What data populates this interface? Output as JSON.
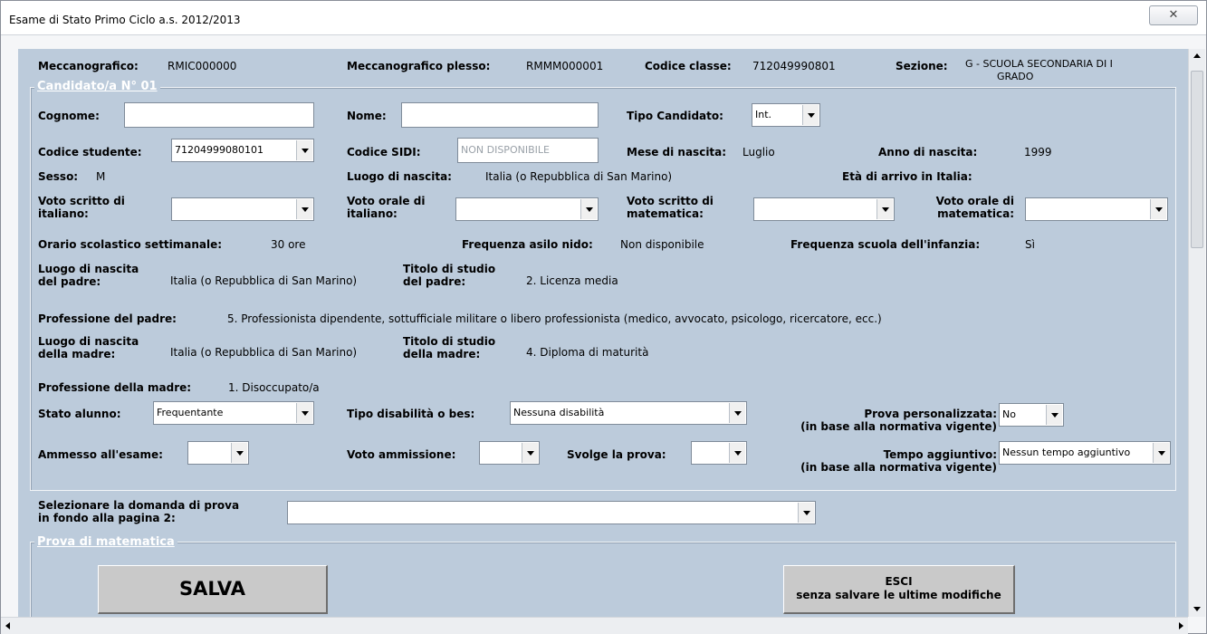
{
  "window": {
    "title": "Esame di Stato Primo Ciclo a.s. 2012/2013",
    "close_glyph": "✕"
  },
  "header": {
    "meccanografico_label": "Meccanografico:",
    "meccanografico_value": "RMIC000000",
    "plesso_label": "Meccanografico plesso:",
    "plesso_value": "RMMM000001",
    "classe_label": "Codice classe:",
    "classe_value": "712049990801",
    "sezione_label": "Sezione:",
    "sezione_value_1": "G  - SCUOLA SECONDARIA DI I",
    "sezione_value_2": "GRADO"
  },
  "candidato": {
    "legend": "Candidato/a N° 01",
    "cognome_label": "Cognome:",
    "cognome_value": "",
    "nome_label": "Nome:",
    "nome_value": "",
    "tipo_label": "Tipo Candidato:",
    "tipo_value": "Int.",
    "codice_studente_label": "Codice studente:",
    "codice_studente_value": "71204999080101",
    "codice_sidi_label": "Codice SIDI:",
    "codice_sidi_value": "NON DISPONIBILE",
    "mese_label": "Mese di nascita:",
    "mese_value": "Luglio",
    "anno_label": "Anno di nascita:",
    "anno_value": "1999",
    "sesso_label": "Sesso:",
    "sesso_value": "M",
    "luogo_label": "Luogo di nascita:",
    "luogo_value": "Italia (o Repubblica di San Marino)",
    "eta_label": "Età di arrivo in Italia:",
    "voto_scritto_ita_1": "Voto scritto di",
    "voto_scritto_ita_2": "italiano:",
    "voto_scritto_ita_value": "",
    "voto_orale_ita_1": "Voto orale di",
    "voto_orale_ita_2": "italiano:",
    "voto_orale_ita_value": "",
    "voto_scritto_mat_1": "Voto scritto di",
    "voto_scritto_mat_2": "matematica:",
    "voto_scritto_mat_value": "",
    "voto_orale_mat_1": "Voto orale di",
    "voto_orale_mat_2": "matematica:",
    "voto_orale_mat_value": "",
    "orario_label": "Orario scolastico settimanale:",
    "orario_value": "30 ore",
    "asilo_label": "Frequenza asilo nido:",
    "asilo_value": "Non disponibile",
    "infanzia_label": "Frequenza scuola dell'infanzia:",
    "infanzia_value": "Sì",
    "luogo_padre_1": "Luogo di nascita",
    "luogo_padre_2": "del padre:",
    "luogo_padre_value": "Italia (o Repubblica di San Marino)",
    "titolo_padre_1": "Titolo di studio",
    "titolo_padre_2": "del padre:",
    "titolo_padre_value": "2. Licenza media",
    "prof_padre_label": "Professione del padre:",
    "prof_padre_value": "5. Professionista dipendente, sottufficiale militare o libero professionista (medico, avvocato, psicologo, ricercatore, ecc.)",
    "luogo_madre_1": "Luogo di nascita",
    "luogo_madre_2": "della madre:",
    "luogo_madre_value": "Italia (o Repubblica di San Marino)",
    "titolo_madre_1": "Titolo di studio",
    "titolo_madre_2": "della madre:",
    "titolo_madre_value": "4. Diploma di maturità",
    "prof_madre_label": "Professione della madre:",
    "prof_madre_value": "1. Disoccupato/a",
    "stato_label": "Stato alunno:",
    "stato_value": "Frequentante",
    "disabilita_label": "Tipo disabilità o bes:",
    "disabilita_value": "Nessuna disabilità",
    "prova_pers_1": "Prova personalizzata:",
    "prova_pers_2": "(in base alla normativa vigente)",
    "prova_pers_value": "No",
    "ammesso_label": "Ammesso all'esame:",
    "ammesso_value": "",
    "voto_amm_label": "Voto ammissione:",
    "voto_amm_value": "",
    "svolge_label": "Svolge la prova:",
    "svolge_value": "",
    "tempo_1": "Tempo aggiuntivo:",
    "tempo_2": "(in base alla normativa vigente)",
    "tempo_value": "Nessun tempo aggiuntivo"
  },
  "prova": {
    "domanda_1": "Selezionare la domanda di prova",
    "domanda_2": "in fondo alla pagina 2:",
    "domanda_value": "",
    "legend": "Prova di matematica"
  },
  "buttons": {
    "salva": "SALVA",
    "esci_1": "ESCI",
    "esci_2": "senza salvare le ultime modifiche"
  }
}
